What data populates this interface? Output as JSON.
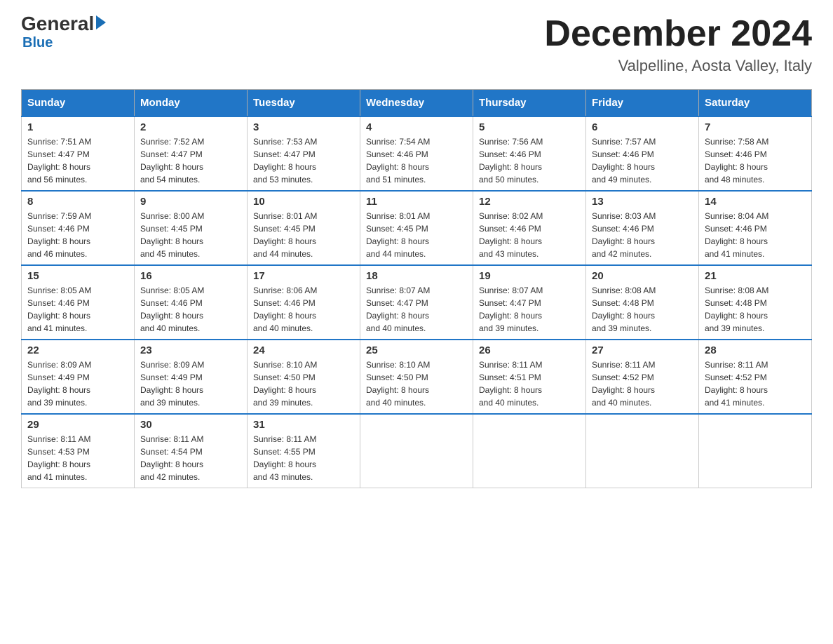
{
  "logo": {
    "general": "General",
    "blue": "Blue"
  },
  "header": {
    "month": "December 2024",
    "location": "Valpelline, Aosta Valley, Italy"
  },
  "days": [
    "Sunday",
    "Monday",
    "Tuesday",
    "Wednesday",
    "Thursday",
    "Friday",
    "Saturday"
  ],
  "weeks": [
    [
      {
        "num": "1",
        "sunrise": "7:51 AM",
        "sunset": "4:47 PM",
        "daylight": "8 hours and 56 minutes."
      },
      {
        "num": "2",
        "sunrise": "7:52 AM",
        "sunset": "4:47 PM",
        "daylight": "8 hours and 54 minutes."
      },
      {
        "num": "3",
        "sunrise": "7:53 AM",
        "sunset": "4:47 PM",
        "daylight": "8 hours and 53 minutes."
      },
      {
        "num": "4",
        "sunrise": "7:54 AM",
        "sunset": "4:46 PM",
        "daylight": "8 hours and 51 minutes."
      },
      {
        "num": "5",
        "sunrise": "7:56 AM",
        "sunset": "4:46 PM",
        "daylight": "8 hours and 50 minutes."
      },
      {
        "num": "6",
        "sunrise": "7:57 AM",
        "sunset": "4:46 PM",
        "daylight": "8 hours and 49 minutes."
      },
      {
        "num": "7",
        "sunrise": "7:58 AM",
        "sunset": "4:46 PM",
        "daylight": "8 hours and 48 minutes."
      }
    ],
    [
      {
        "num": "8",
        "sunrise": "7:59 AM",
        "sunset": "4:46 PM",
        "daylight": "8 hours and 46 minutes."
      },
      {
        "num": "9",
        "sunrise": "8:00 AM",
        "sunset": "4:45 PM",
        "daylight": "8 hours and 45 minutes."
      },
      {
        "num": "10",
        "sunrise": "8:01 AM",
        "sunset": "4:45 PM",
        "daylight": "8 hours and 44 minutes."
      },
      {
        "num": "11",
        "sunrise": "8:01 AM",
        "sunset": "4:45 PM",
        "daylight": "8 hours and 44 minutes."
      },
      {
        "num": "12",
        "sunrise": "8:02 AM",
        "sunset": "4:46 PM",
        "daylight": "8 hours and 43 minutes."
      },
      {
        "num": "13",
        "sunrise": "8:03 AM",
        "sunset": "4:46 PM",
        "daylight": "8 hours and 42 minutes."
      },
      {
        "num": "14",
        "sunrise": "8:04 AM",
        "sunset": "4:46 PM",
        "daylight": "8 hours and 41 minutes."
      }
    ],
    [
      {
        "num": "15",
        "sunrise": "8:05 AM",
        "sunset": "4:46 PM",
        "daylight": "8 hours and 41 minutes."
      },
      {
        "num": "16",
        "sunrise": "8:05 AM",
        "sunset": "4:46 PM",
        "daylight": "8 hours and 40 minutes."
      },
      {
        "num": "17",
        "sunrise": "8:06 AM",
        "sunset": "4:46 PM",
        "daylight": "8 hours and 40 minutes."
      },
      {
        "num": "18",
        "sunrise": "8:07 AM",
        "sunset": "4:47 PM",
        "daylight": "8 hours and 40 minutes."
      },
      {
        "num": "19",
        "sunrise": "8:07 AM",
        "sunset": "4:47 PM",
        "daylight": "8 hours and 39 minutes."
      },
      {
        "num": "20",
        "sunrise": "8:08 AM",
        "sunset": "4:48 PM",
        "daylight": "8 hours and 39 minutes."
      },
      {
        "num": "21",
        "sunrise": "8:08 AM",
        "sunset": "4:48 PM",
        "daylight": "8 hours and 39 minutes."
      }
    ],
    [
      {
        "num": "22",
        "sunrise": "8:09 AM",
        "sunset": "4:49 PM",
        "daylight": "8 hours and 39 minutes."
      },
      {
        "num": "23",
        "sunrise": "8:09 AM",
        "sunset": "4:49 PM",
        "daylight": "8 hours and 39 minutes."
      },
      {
        "num": "24",
        "sunrise": "8:10 AM",
        "sunset": "4:50 PM",
        "daylight": "8 hours and 39 minutes."
      },
      {
        "num": "25",
        "sunrise": "8:10 AM",
        "sunset": "4:50 PM",
        "daylight": "8 hours and 40 minutes."
      },
      {
        "num": "26",
        "sunrise": "8:11 AM",
        "sunset": "4:51 PM",
        "daylight": "8 hours and 40 minutes."
      },
      {
        "num": "27",
        "sunrise": "8:11 AM",
        "sunset": "4:52 PM",
        "daylight": "8 hours and 40 minutes."
      },
      {
        "num": "28",
        "sunrise": "8:11 AM",
        "sunset": "4:52 PM",
        "daylight": "8 hours and 41 minutes."
      }
    ],
    [
      {
        "num": "29",
        "sunrise": "8:11 AM",
        "sunset": "4:53 PM",
        "daylight": "8 hours and 41 minutes."
      },
      {
        "num": "30",
        "sunrise": "8:11 AM",
        "sunset": "4:54 PM",
        "daylight": "8 hours and 42 minutes."
      },
      {
        "num": "31",
        "sunrise": "8:11 AM",
        "sunset": "4:55 PM",
        "daylight": "8 hours and 43 minutes."
      },
      null,
      null,
      null,
      null
    ]
  ],
  "labels": {
    "sunrise": "Sunrise:",
    "sunset": "Sunset:",
    "daylight": "Daylight:"
  }
}
